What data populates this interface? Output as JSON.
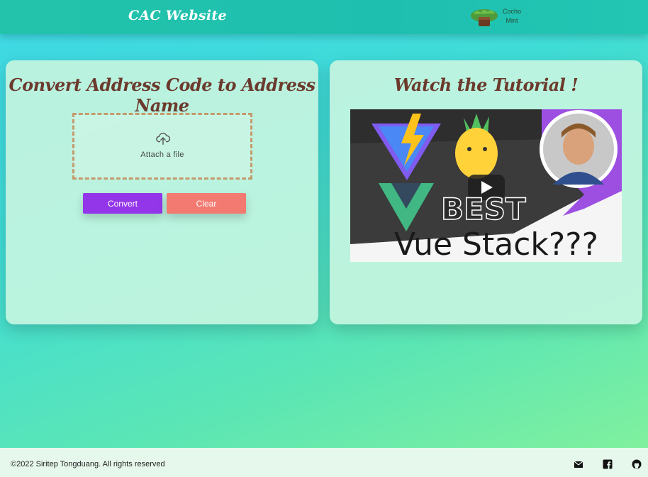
{
  "header": {
    "brand": "CAC Website",
    "user_name_line1": "Cocho",
    "user_name_line2": "Mint",
    "user_avatar_icon": "cactus-avatar-icon"
  },
  "converter": {
    "title": "Convert Address Code to Address Name",
    "dropzone_label": "Attach a file",
    "dropzone_icon": "cloud-upload-icon",
    "convert_label": "Convert",
    "clear_label": "Clear"
  },
  "tutorial": {
    "title": "Watch the Tutorial !",
    "thumbnail_line1": "BEST",
    "thumbnail_line2": "Vue Stack???",
    "play_icon": "play-icon"
  },
  "footer": {
    "copyright": "©2022 Siritep Tongduang. All rights reserved",
    "icons": [
      "mail-icon",
      "facebook-icon",
      "github-icon"
    ]
  },
  "colors": {
    "header": "#1fbfb0",
    "title_brown": "#6b3a2c",
    "convert_button": "#9335e8",
    "clear_button": "#f27a70"
  }
}
